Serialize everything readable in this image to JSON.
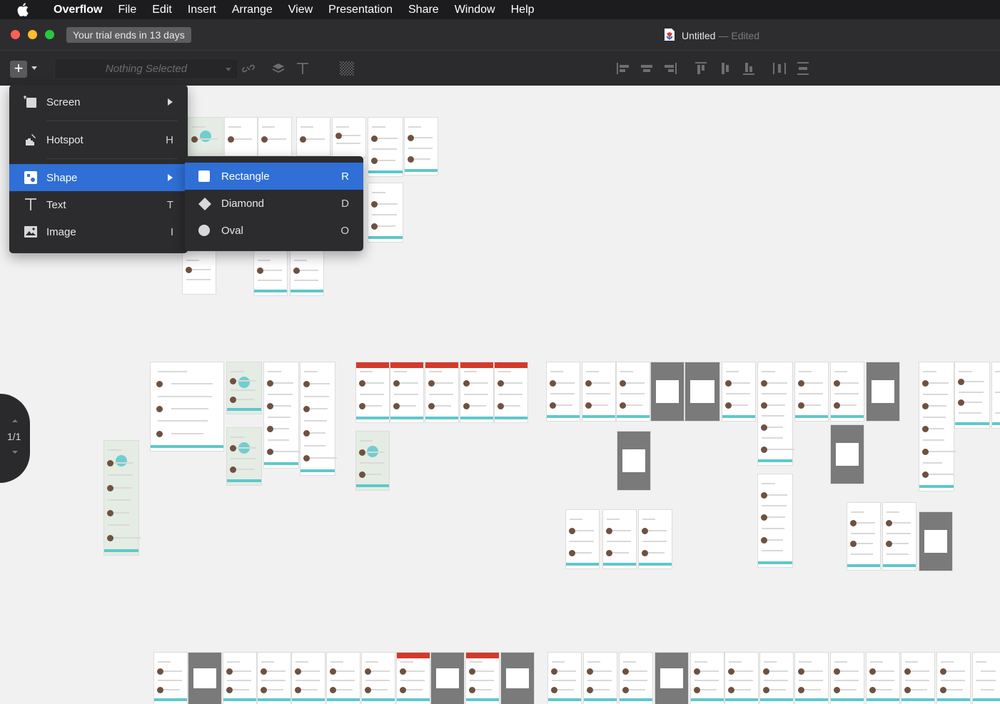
{
  "menubar": {
    "app": "Overflow",
    "items": [
      "File",
      "Edit",
      "Insert",
      "Arrange",
      "View",
      "Presentation",
      "Share",
      "Window",
      "Help"
    ]
  },
  "window": {
    "trial_text": "Your trial ends in 13 days",
    "doc_title": "Untitled",
    "doc_status": "— Edited"
  },
  "toolbar": {
    "selection_placeholder": "Nothing Selected",
    "add_icon": "plus-icon",
    "icons": [
      "unlink-icon",
      "layers-icon",
      "text-tool-icon",
      "pattern-icon",
      "align-left-icon",
      "align-center-icon",
      "align-right-icon",
      "align-top-icon",
      "align-middle-icon",
      "align-bottom-icon",
      "distribute-horizontal-icon",
      "distribute-vertical-icon"
    ]
  },
  "insert_menu": {
    "items": [
      {
        "label": "Screen",
        "shortcut": "",
        "submenu": true,
        "icon": "screen-icon"
      },
      {
        "label": "Hotspot",
        "shortcut": "H",
        "submenu": false,
        "icon": "hotspot-icon"
      },
      {
        "label": "Shape",
        "shortcut": "",
        "submenu": true,
        "icon": "shape-icon"
      },
      {
        "label": "Text",
        "shortcut": "T",
        "submenu": false,
        "icon": "text-icon"
      },
      {
        "label": "Image",
        "shortcut": "I",
        "submenu": false,
        "icon": "image-icon"
      }
    ],
    "highlighted": "Shape"
  },
  "shape_submenu": {
    "items": [
      {
        "label": "Rectangle",
        "shortcut": "R",
        "icon": "rectangle-icon"
      },
      {
        "label": "Diamond",
        "shortcut": "D",
        "icon": "diamond-icon"
      },
      {
        "label": "Oval",
        "shortcut": "O",
        "icon": "oval-icon"
      }
    ],
    "highlighted": "Rectangle"
  },
  "pager": {
    "label": "1/1"
  },
  "colors": {
    "accent": "#5ec8cc",
    "highlight": "#2f6fd6",
    "menu_bg": "#2c2c2e",
    "red_header": "#d33a2c"
  }
}
